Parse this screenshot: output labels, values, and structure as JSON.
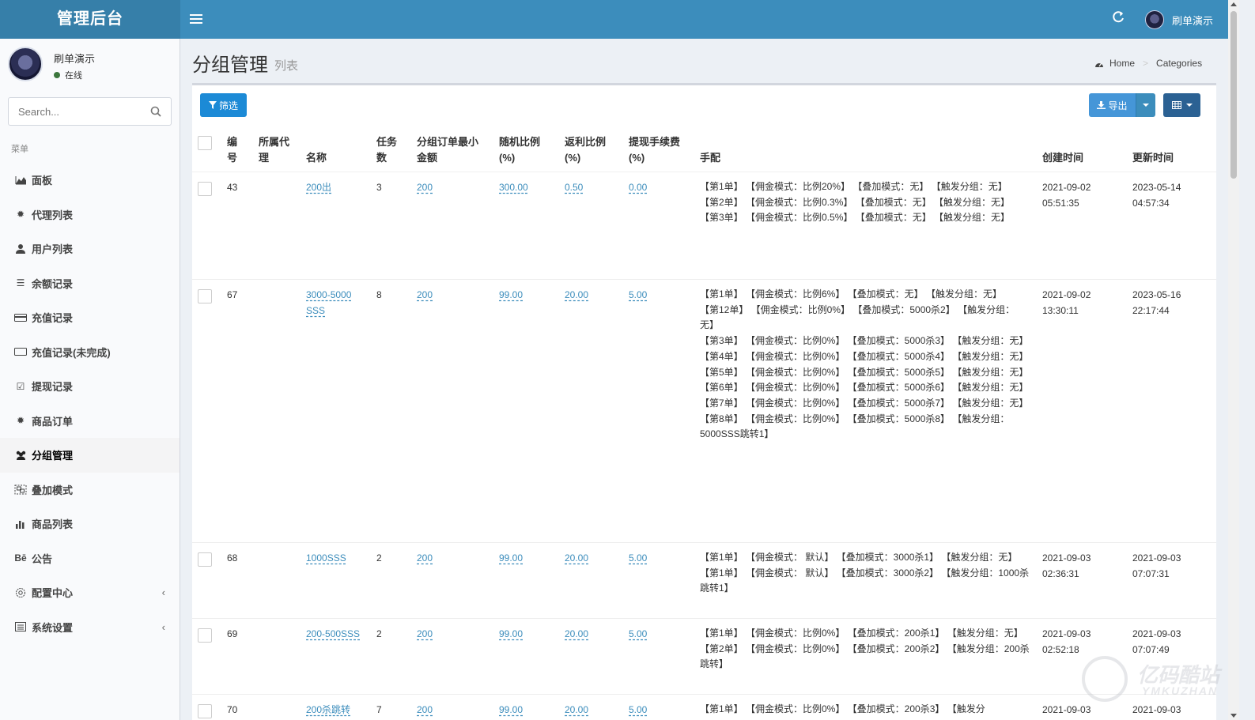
{
  "app": {
    "title": "管理后台"
  },
  "header": {
    "user_name": "刷单演示"
  },
  "sidebar": {
    "user": {
      "name": "刷单演示",
      "status": "在线"
    },
    "search_placeholder": "Search...",
    "menu_header": "菜单",
    "items": [
      {
        "label": "面板",
        "icon": "area-chart-icon"
      },
      {
        "label": "代理列表",
        "icon": "gear-icon"
      },
      {
        "label": "用户列表",
        "icon": "user-icon"
      },
      {
        "label": "余额记录",
        "icon": "list-icon"
      },
      {
        "label": "充值记录",
        "icon": "credit-card-icon"
      },
      {
        "label": "充值记录(未完成)",
        "icon": "card-outline-icon"
      },
      {
        "label": "提现记录",
        "icon": "check-square-icon"
      },
      {
        "label": "商品订单",
        "icon": "gear-icon"
      },
      {
        "label": "分组管理",
        "icon": "users-icon"
      },
      {
        "label": "叠加模式",
        "icon": "object-group-icon"
      },
      {
        "label": "商品列表",
        "icon": "bar-chart-icon"
      },
      {
        "label": "公告",
        "icon": "behance-icon"
      },
      {
        "label": "配置中心",
        "icon": "cog-outline-icon"
      },
      {
        "label": "系统设置",
        "icon": "list-alt-icon"
      }
    ]
  },
  "page": {
    "title": "分组管理",
    "subtitle": "列表"
  },
  "breadcrumb": {
    "home": "Home",
    "current": "Categories"
  },
  "toolbar": {
    "filter_label": "筛选",
    "export_label": "导出"
  },
  "table": {
    "columns": {
      "id": "编号",
      "agent": "所属代理",
      "name": "名称",
      "tasks": "任务数",
      "min_amount": "分组订单最小金额",
      "random_ratio": "随机比例(%)",
      "rebate_ratio": "返利比例(%)",
      "fee": "提现手续费(%)",
      "manual": "手配",
      "created": "创建时间",
      "updated": "更新时间"
    },
    "rows": [
      {
        "id": "43",
        "agent": "",
        "name": "200出",
        "tasks": "3",
        "min_amount": "200",
        "random_ratio": "300.00",
        "rebate_ratio": "0.50",
        "fee": "0.00",
        "manual": "【第1单】 【佣金模式：比例20%】 【叠加模式：无】 【触发分组：无】\n【第2单】 【佣金模式：比例0.3%】 【叠加模式：无】 【触发分组：无】\n【第3单】 【佣金模式：比例0.5%】 【叠加模式：无】 【触发分组：无】",
        "created": "2021-09-02 05:51:35",
        "updated": "2023-05-14 04:57:34"
      },
      {
        "id": "67",
        "agent": "",
        "name": "3000-5000SSS",
        "tasks": "8",
        "min_amount": "200",
        "random_ratio": "99.00",
        "rebate_ratio": "20.00",
        "fee": "5.00",
        "manual": "【第1单】 【佣金模式：比例6%】 【叠加模式：无】 【触发分组：无】\n【第12单】 【佣金模式：比例0%】 【叠加模式：5000杀2】 【触发分组：无】\n【第3单】 【佣金模式：比例0%】 【叠加模式：5000杀3】 【触发分组：无】\n【第4单】 【佣金模式：比例0%】 【叠加模式：5000杀4】 【触发分组：无】\n【第5单】 【佣金模式：比例0%】 【叠加模式：5000杀5】 【触发分组：无】\n【第6单】 【佣金模式：比例0%】 【叠加模式：5000杀6】 【触发分组：无】\n【第7单】 【佣金模式：比例0%】 【叠加模式：5000杀7】 【触发分组：无】\n【第8单】 【佣金模式：比例0%】 【叠加模式：5000杀8】 【触发分组：5000SSS跳转1】",
        "created": "2021-09-02 13:30:11",
        "updated": "2023-05-16 22:17:44"
      },
      {
        "id": "68",
        "agent": "",
        "name": "1000SSS",
        "tasks": "2",
        "min_amount": "200",
        "random_ratio": "99.00",
        "rebate_ratio": "20.00",
        "fee": "5.00",
        "manual": "【第1单】 【佣金模式： 默认】 【叠加模式：3000杀1】 【触发分组：无】\n【第1单】 【佣金模式： 默认】 【叠加模式：3000杀2】 【触发分组：1000杀跳转1】",
        "created": "2021-09-03 02:36:31",
        "updated": "2021-09-03 07:07:31"
      },
      {
        "id": "69",
        "agent": "",
        "name": "200-500SSS",
        "tasks": "2",
        "min_amount": "200",
        "random_ratio": "99.00",
        "rebate_ratio": "20.00",
        "fee": "5.00",
        "manual": "【第1单】 【佣金模式：比例0%】 【叠加模式：200杀1】 【触发分组：无】\n【第2单】 【佣金模式：比例0%】 【叠加模式：200杀2】 【触发分组：200杀跳转】",
        "created": "2021-09-03 02:52:18",
        "updated": "2021-09-03 07:07:49"
      },
      {
        "id": "70",
        "agent": "",
        "name": "200杀跳转",
        "tasks": "7",
        "min_amount": "200",
        "random_ratio": "99.00",
        "rebate_ratio": "20.00",
        "fee": "5.00",
        "manual": "【第1单】 【佣金模式：比例0%】 【叠加模式：200杀3】 【触发分",
        "created": "2021-09-03",
        "updated": "2021-09-03"
      }
    ]
  },
  "watermark": {
    "big": "亿码酷站",
    "small": "YMKUZHAN"
  }
}
